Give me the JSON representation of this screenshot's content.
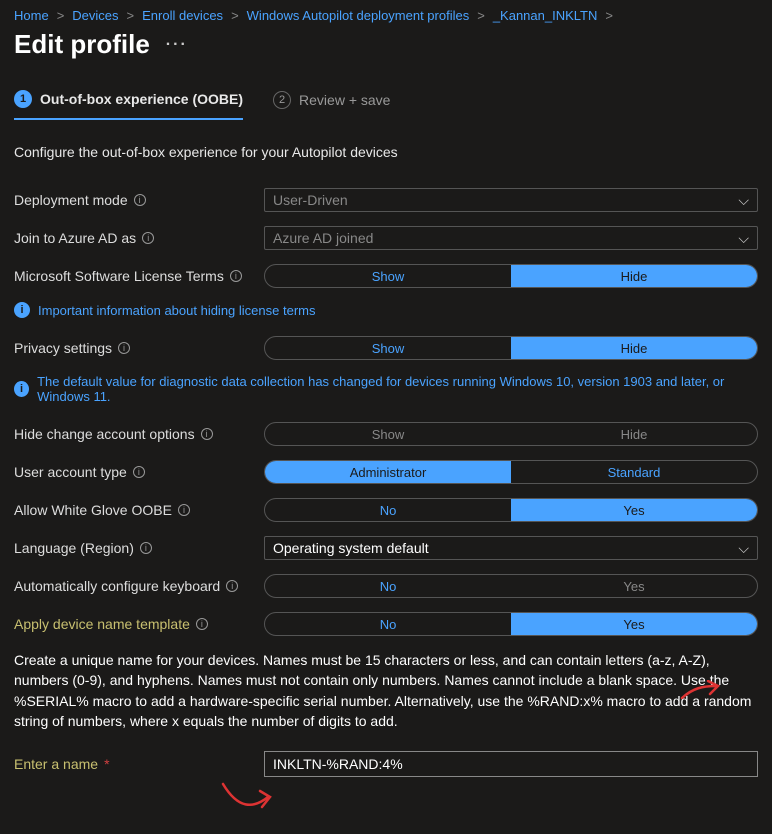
{
  "breadcrumb": [
    "Home",
    "Devices",
    "Enroll devices",
    "Windows Autopilot deployment profiles",
    "_Kannan_INKLTN"
  ],
  "page_title": "Edit profile",
  "tabs": [
    {
      "num": "1",
      "label": "Out-of-box experience (OOBE)"
    },
    {
      "num": "2",
      "label": "Review + save"
    }
  ],
  "description": "Configure the out-of-box experience for your Autopilot devices",
  "rows": {
    "deployment_mode": {
      "label": "Deployment mode",
      "value": "User-Driven"
    },
    "join_aad": {
      "label": "Join to Azure AD as",
      "value": "Azure AD joined"
    },
    "license_terms": {
      "label": "Microsoft Software License Terms",
      "opt1": "Show",
      "opt2": "Hide"
    },
    "privacy": {
      "label": "Privacy settings",
      "opt1": "Show",
      "opt2": "Hide"
    },
    "hide_change_account": {
      "label": "Hide change account options",
      "opt1": "Show",
      "opt2": "Hide"
    },
    "user_account_type": {
      "label": "User account type",
      "opt1": "Administrator",
      "opt2": "Standard"
    },
    "white_glove": {
      "label": "Allow White Glove OOBE",
      "opt1": "No",
      "opt2": "Yes"
    },
    "language": {
      "label": "Language (Region)",
      "value": "Operating system default"
    },
    "auto_keyboard": {
      "label": "Automatically configure keyboard",
      "opt1": "No",
      "opt2": "Yes"
    },
    "name_template": {
      "label": "Apply device name template",
      "opt1": "No",
      "opt2": "Yes"
    },
    "enter_name": {
      "label": "Enter a name",
      "value": "INKLTN-%RAND:4%"
    }
  },
  "info_lines": {
    "license": "Important information about hiding license terms",
    "privacy": "The default value for diagnostic data collection has changed for devices running Windows 10, version 1903 and later, or Windows 11."
  },
  "help_text": "Create a unique name for your devices. Names must be 15 characters or less, and can contain letters (a-z, A-Z), numbers (0-9), and hyphens. Names must not contain only numbers. Names cannot include a blank space. Use the %SERIAL% macro to add a hardware-specific serial number. Alternatively, use the %RAND:x% macro to add a random string of numbers, where x equals the number of digits to add."
}
